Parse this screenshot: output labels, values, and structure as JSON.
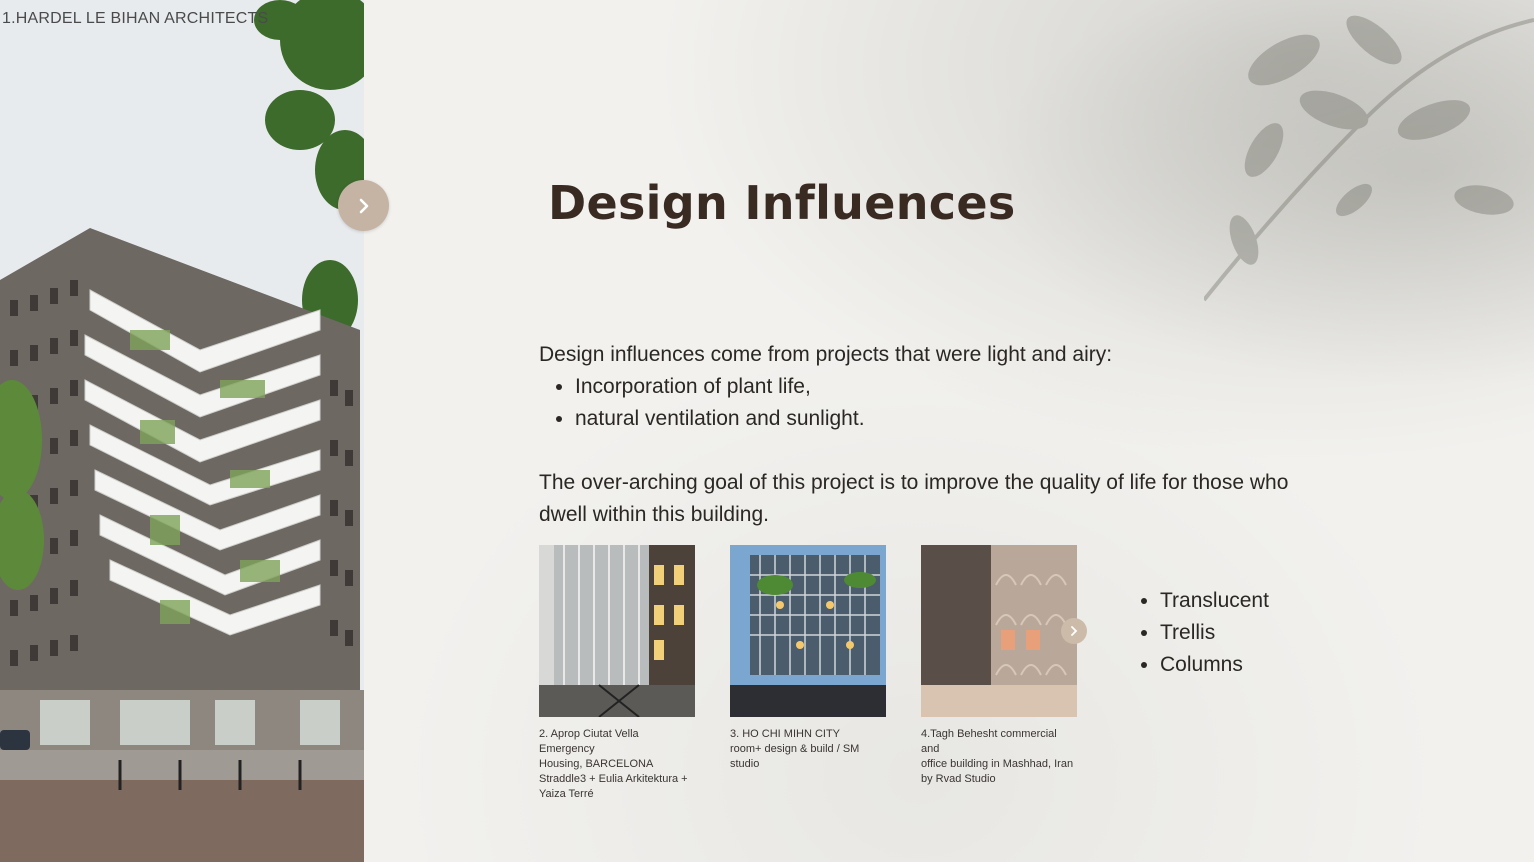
{
  "slide": {
    "photo_caption": "1.HARDEL LE BIHAN ARCHITECTS",
    "title": "Design Influences",
    "intro": "Design influences come from projects that were light and airy:",
    "bullets": [
      "Incorporation of plant life,",
      "natural ventilation and sunlight."
    ],
    "goal": "The over-arching goal of this project is to improve the quality of life for those who dwell within this building.",
    "cards": [
      {
        "caption_lines": [
          "2. Aprop Ciutat Vella Emergency",
          "Housing, BARCELONA",
          "Straddle3 + Eulia Arkitektura +",
          "Yaiza Terré"
        ]
      },
      {
        "caption_lines": [
          "3. HO CHI MIHN CITY",
          "room+ design & build / SM",
          "studio"
        ]
      },
      {
        "caption_lines": [
          "4.Tagh Behesht commercial and",
          "office building in Mashhad, Iran",
          "by Rvad Studio"
        ]
      }
    ],
    "features": [
      "Translucent",
      "Trellis",
      "Columns"
    ]
  },
  "icons": {
    "next": "chevron-right-icon",
    "small_next": "chevron-right-icon"
  },
  "colors": {
    "accent": "#c5b4a4",
    "title": "#3a2b22",
    "background": "#f2f1ee"
  }
}
